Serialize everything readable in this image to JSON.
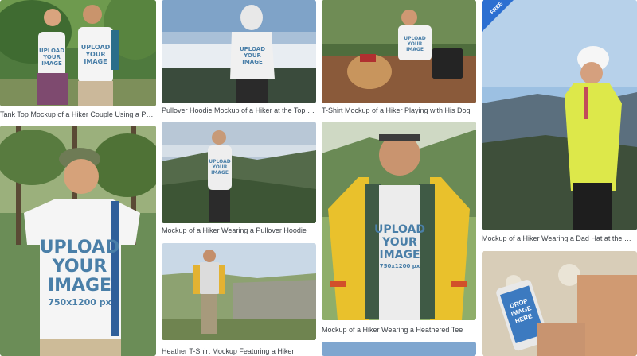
{
  "cards": [
    {
      "caption": "Tank Top Mockup of a Hiker Couple Using a Phone"
    },
    {
      "caption": "Pullover Hoodie Mockup of a Hiker at the Top of a Mountain"
    },
    {
      "caption": "T-Shirt Mockup of a Hiker Playing with His Dog"
    },
    {
      "caption": "Mockup of a Hiker Wearing a Dad Hat at the Mountains"
    },
    {
      "caption": ""
    },
    {
      "caption": "Mockup of a Hiker Wearing a Pullover Hoodie"
    },
    {
      "caption": "Mockup of a Hiker Wearing a Heathered Tee"
    },
    {
      "caption": "Heather T-Shirt Mockup Featuring a Hiker"
    },
    {
      "caption": ""
    }
  ],
  "placeholder": {
    "line1": "UPLOAD",
    "line2": "YOUR",
    "line3": "IMAGE",
    "size": "750x1200 px",
    "size_large": "750x1200 px"
  },
  "phone_placeholder": {
    "line1": "DROP",
    "line2": "IMAGE",
    "line3": "HERE"
  },
  "badge": {
    "label": "FREE"
  },
  "colors": {
    "caption_text": "#3a3f45",
    "tee_print": "#4a7fa8",
    "badge_bg": "#2c6fd1",
    "background": "#ffffff"
  }
}
